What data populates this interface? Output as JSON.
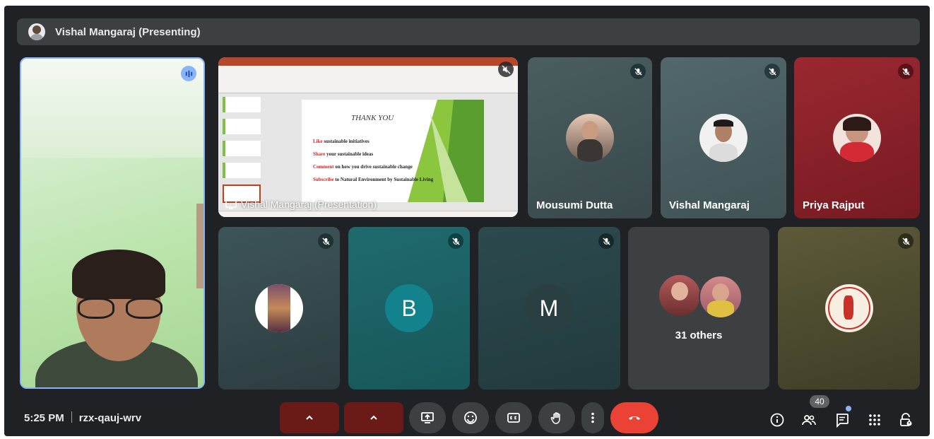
{
  "presenting_bar": {
    "text": "Vishal Mangaraj (Presenting)"
  },
  "presentation": {
    "label": "Vishal Mangaraj (Presentation)",
    "slide": {
      "title": "THANK YOU",
      "lines": [
        {
          "red": "Like",
          "rest": " sustainable initiatives"
        },
        {
          "red": "Share",
          "rest": " your sustainable ideas"
        },
        {
          "red": "Comment",
          "rest": " on how you drive sustainable change"
        },
        {
          "red": "Subscribe",
          "rest": " to Natural Environment by Sustainable Living"
        }
      ]
    }
  },
  "participants": [
    {
      "name": "Mousumi Dutta"
    },
    {
      "name": "Vishal Mangaraj"
    },
    {
      "name": "Priya Rajput"
    }
  ],
  "letter_tiles": {
    "b": "B",
    "m": "M"
  },
  "others": {
    "label": "31 others"
  },
  "meeting": {
    "time": "5:25 PM",
    "code": "rzx-qauj-wrv"
  },
  "participant_count": "40",
  "colors": {
    "background": "#202124",
    "control_gray": "#3c4043",
    "end_call": "#ea4335",
    "off_control": "#6b1b17",
    "active_speaker": "#8ab4f8"
  }
}
